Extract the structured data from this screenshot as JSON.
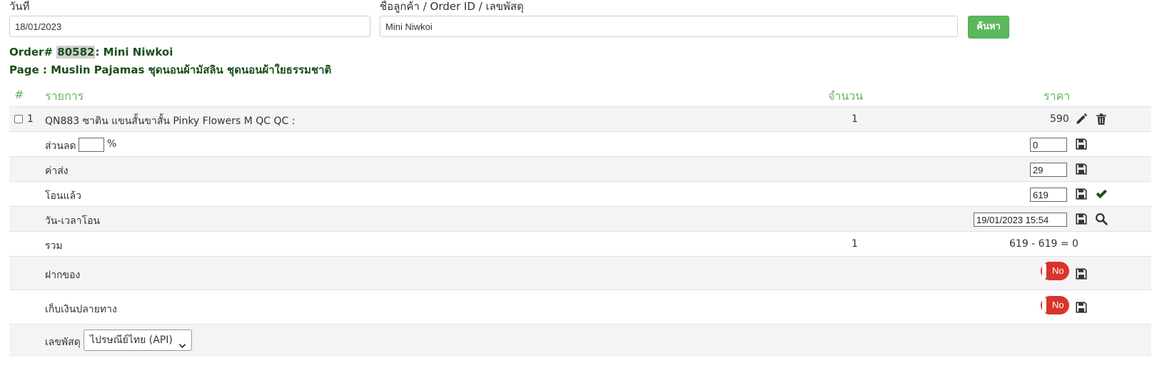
{
  "search": {
    "date_label": "วันที่",
    "date_value": "18/01/2023",
    "query_label": "ชื่อลูกค้า / Order ID / เลขพัสดุ",
    "query_value": "Mini Niwkoi",
    "button": "ค้นหา"
  },
  "order": {
    "prefix": "Order#",
    "id": "80582",
    "customer": ": Mini Niwkoi",
    "page_line": "Page : Muslin Pajamas ชุดนอนผ้ามัสลิน ชุดนอนผ้าใยธรรมชาติ"
  },
  "table": {
    "headers": {
      "index": "#",
      "item": "รายการ",
      "qty": "จำนวน",
      "price": "ราคา"
    },
    "item": {
      "index": "1",
      "name": "QN883 ซาติน แขนสั้นขาสั้น Pinky Flowers M QC QC :",
      "qty": "1",
      "price": "590"
    },
    "discount": {
      "label": "ส่วนลด",
      "pct_value": "",
      "pct_sign": "%",
      "value": "0"
    },
    "shipping": {
      "label": "ค่าส่ง",
      "value": "29"
    },
    "paid": {
      "label": "โอนแล้ว",
      "value": "619"
    },
    "transfer_time": {
      "label": "วัน-เวลาโอน",
      "value": "19/01/2023 15:54"
    },
    "total": {
      "label": "รวม",
      "qty": "1",
      "value": "619 - 619 = 0"
    },
    "deposit": {
      "label": "ฝากของ",
      "toggle": "No"
    },
    "cod": {
      "label": "เก็บเงินปลายทาง",
      "toggle": "No"
    },
    "tracking": {
      "label": "เลขพัสดุ",
      "carrier": "ไปรษณีย์ไทย (API)"
    }
  },
  "colors": {
    "accent": "#5cb85c",
    "title": "#1a4d1a",
    "toggle_off": "#d9342b"
  },
  "icons": [
    "pencil-icon",
    "trash-icon",
    "save-icon",
    "check-icon",
    "search-icon",
    "chevron-down-icon"
  ]
}
